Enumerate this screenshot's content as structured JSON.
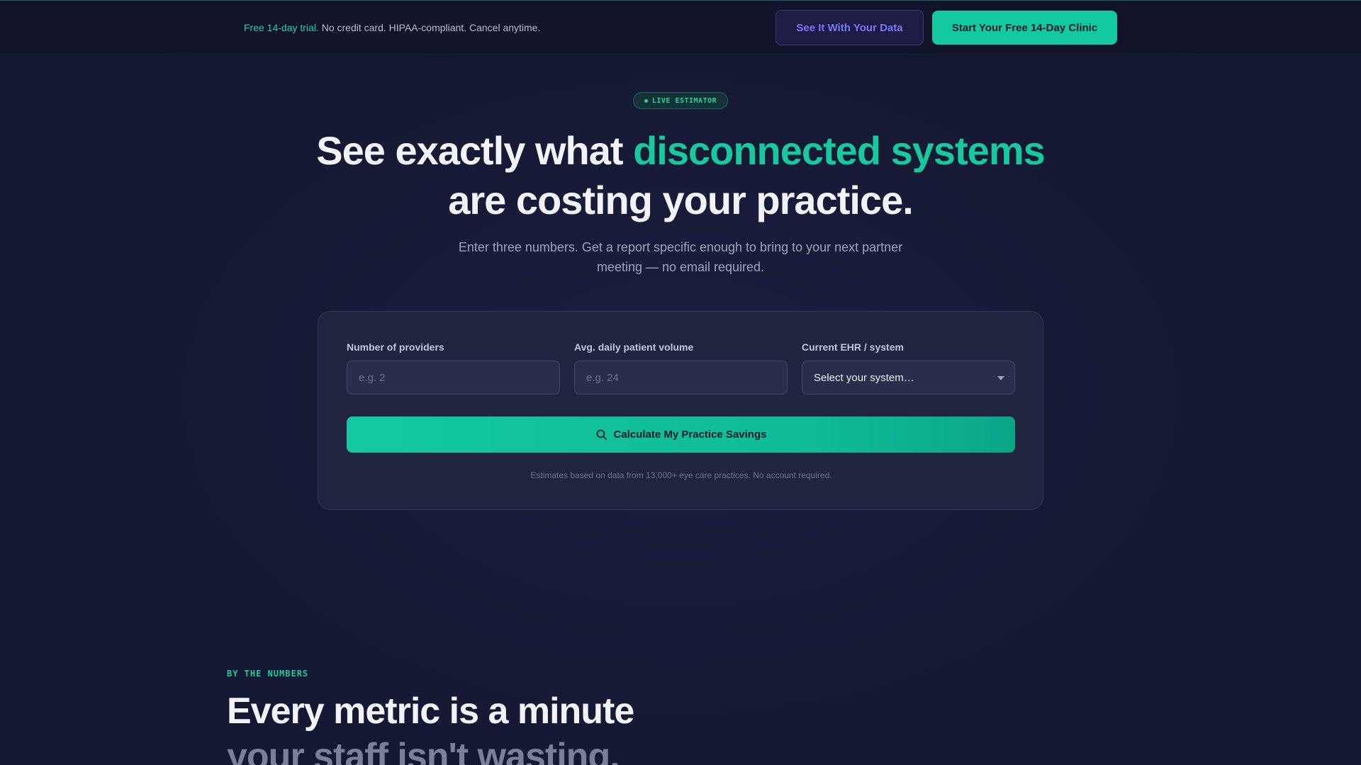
{
  "topbar": {
    "trial_accent": "Free 14-day trial.",
    "trial_rest": " No credit card. HIPAA-compliant. Cancel anytime.",
    "secondary_cta": "See It With Your Data",
    "primary_cta": "Start Your Free 14-Day Clinic"
  },
  "hero": {
    "badge": "LIVE ESTIMATOR",
    "title_part1": "See exactly what ",
    "title_highlight": "disconnected systems",
    "title_part2": "are costing your practice.",
    "subtitle": "Enter three numbers. Get a report specific enough to bring to your next partner meeting — no email required."
  },
  "estimator": {
    "providers_label": "Number of providers",
    "providers_placeholder": "e.g. 2",
    "volume_label": "Avg. daily patient volume",
    "volume_placeholder": "e.g. 24",
    "ehr_label": "Current EHR / system",
    "ehr_selected": "Select your system…",
    "calculate_label": "Calculate My Practice Savings",
    "note": "Estimates based on data from 13,000+ eye care practices. No account required."
  },
  "numbers_section": {
    "eyebrow": "BY THE NUMBERS",
    "title_line1": "Every metric is a minute",
    "title_line2": "your staff isn't wasting."
  },
  "colors": {
    "accent": "#12c9a1",
    "secondary_accent": "#7d76f2",
    "background": "#141831"
  }
}
